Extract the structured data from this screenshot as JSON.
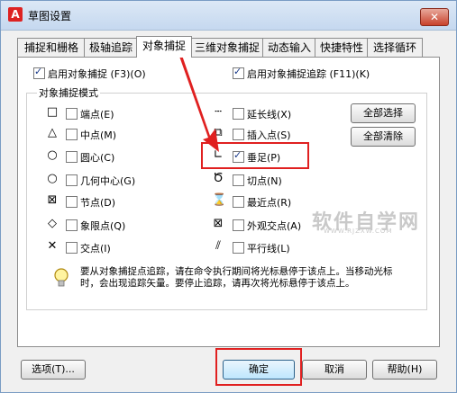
{
  "window": {
    "title": "草图设置",
    "close": "✕",
    "app_icon": "A"
  },
  "tabs": [
    "捕捉和栅格",
    "极轴追踪",
    "对象捕捉",
    "三维对象捕捉",
    "动态输入",
    "快捷特性",
    "选择循环"
  ],
  "top_options": {
    "snap_on": {
      "label": "启用对象捕捉 (F3)(O)",
      "checked": true
    },
    "tracking_on": {
      "label": "启用对象捕捉追踪 (F11)(K)",
      "checked": true
    }
  },
  "group_title": "对象捕捉模式",
  "modes_left": [
    {
      "symbol": "□",
      "label": "端点(E)",
      "checked": false
    },
    {
      "symbol": "△",
      "label": "中点(M)",
      "checked": false
    },
    {
      "symbol": "○",
      "label": "圆心(C)",
      "checked": false
    },
    {
      "symbol": "○",
      "label": "几何中心(G)",
      "checked": false
    },
    {
      "symbol": "⊠",
      "label": "节点(D)",
      "checked": false
    },
    {
      "symbol": "◇",
      "label": "象限点(Q)",
      "checked": false
    },
    {
      "symbol": "✕",
      "label": "交点(I)",
      "checked": false
    }
  ],
  "modes_right": [
    {
      "symbol": "┄",
      "label": "延长线(X)",
      "checked": false
    },
    {
      "symbol": "⧉",
      "label": "插入点(S)",
      "checked": false
    },
    {
      "symbol": "∟",
      "label": "垂足(P)",
      "checked": true
    },
    {
      "symbol": "Ծ",
      "label": "切点(N)",
      "checked": false
    },
    {
      "symbol": "⌛",
      "label": "最近点(R)",
      "checked": false
    },
    {
      "symbol": "⊠",
      "label": "外观交点(A)",
      "checked": false
    },
    {
      "symbol": "⫽",
      "label": "平行线(L)",
      "checked": false
    }
  ],
  "buttons": {
    "select_all": "全部选择",
    "clear_all": "全部清除",
    "options": "选项(T)...",
    "ok": "确定",
    "cancel": "取消",
    "help": "帮助(H)"
  },
  "hint": "要从对象捕捉点追踪，请在命令执行期间将光标悬停于该点上。当移动光标时，会出现追踪矢量。要停止追踪，请再次将光标悬停于该点上。",
  "watermark": {
    "text": "软件自学网",
    "sub": "WWW.RJZXW.COM"
  },
  "colors": {
    "highlight": "#e02020",
    "check": "#1a3a8a"
  }
}
